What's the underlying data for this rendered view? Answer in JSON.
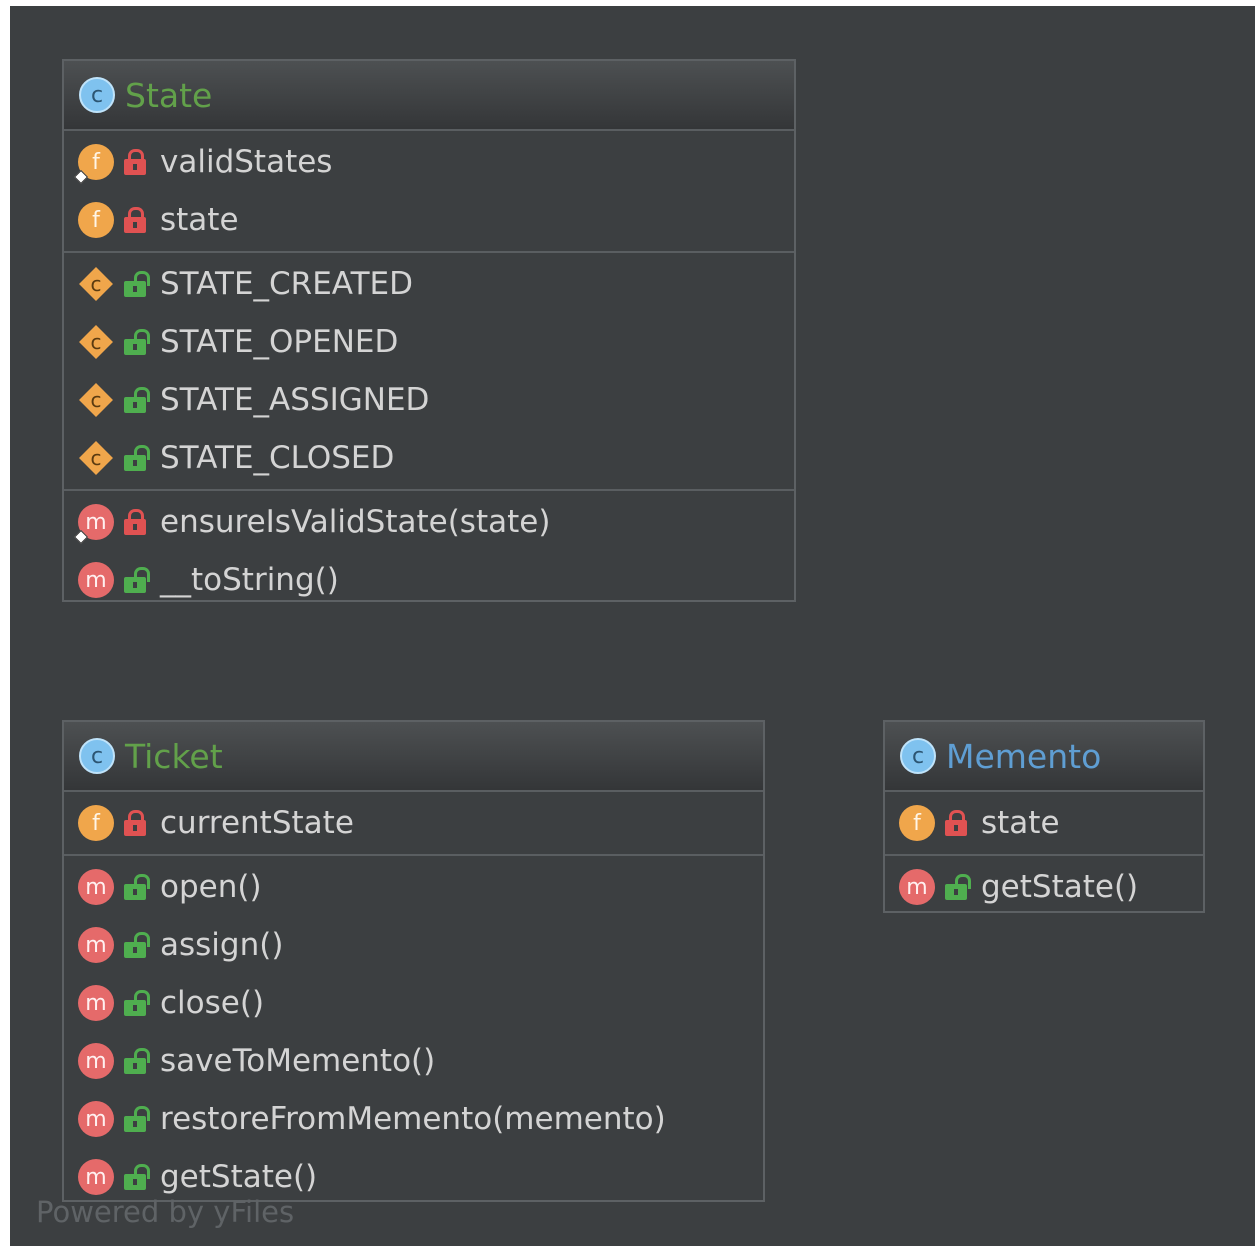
{
  "classes": {
    "state": {
      "name": "State",
      "fields": [
        "validStates",
        "state"
      ],
      "constants": [
        "STATE_CREATED",
        "STATE_OPENED",
        "STATE_ASSIGNED",
        "STATE_CLOSED"
      ],
      "methods": [
        "ensureIsValidState(state)",
        "__toString()"
      ]
    },
    "ticket": {
      "name": "Ticket",
      "fields": [
        "currentState"
      ],
      "methods": [
        "open()",
        "assign()",
        "close()",
        "saveToMemento()",
        "restoreFromMemento(memento)",
        "getState()"
      ]
    },
    "memento": {
      "name": "Memento",
      "fields": [
        "state"
      ],
      "methods": [
        "getState()"
      ]
    }
  },
  "icons": {
    "class_badge": "c",
    "field_badge": "f",
    "method_badge": "m",
    "constant_badge": "c"
  },
  "footer": "Powered by yFiles",
  "colors": {
    "background": "#3c3f41",
    "class_name_green": "#62a14a",
    "class_name_blue": "#5f9ed3",
    "private_lock": "#e05252",
    "public_lock": "#4fae4f"
  }
}
